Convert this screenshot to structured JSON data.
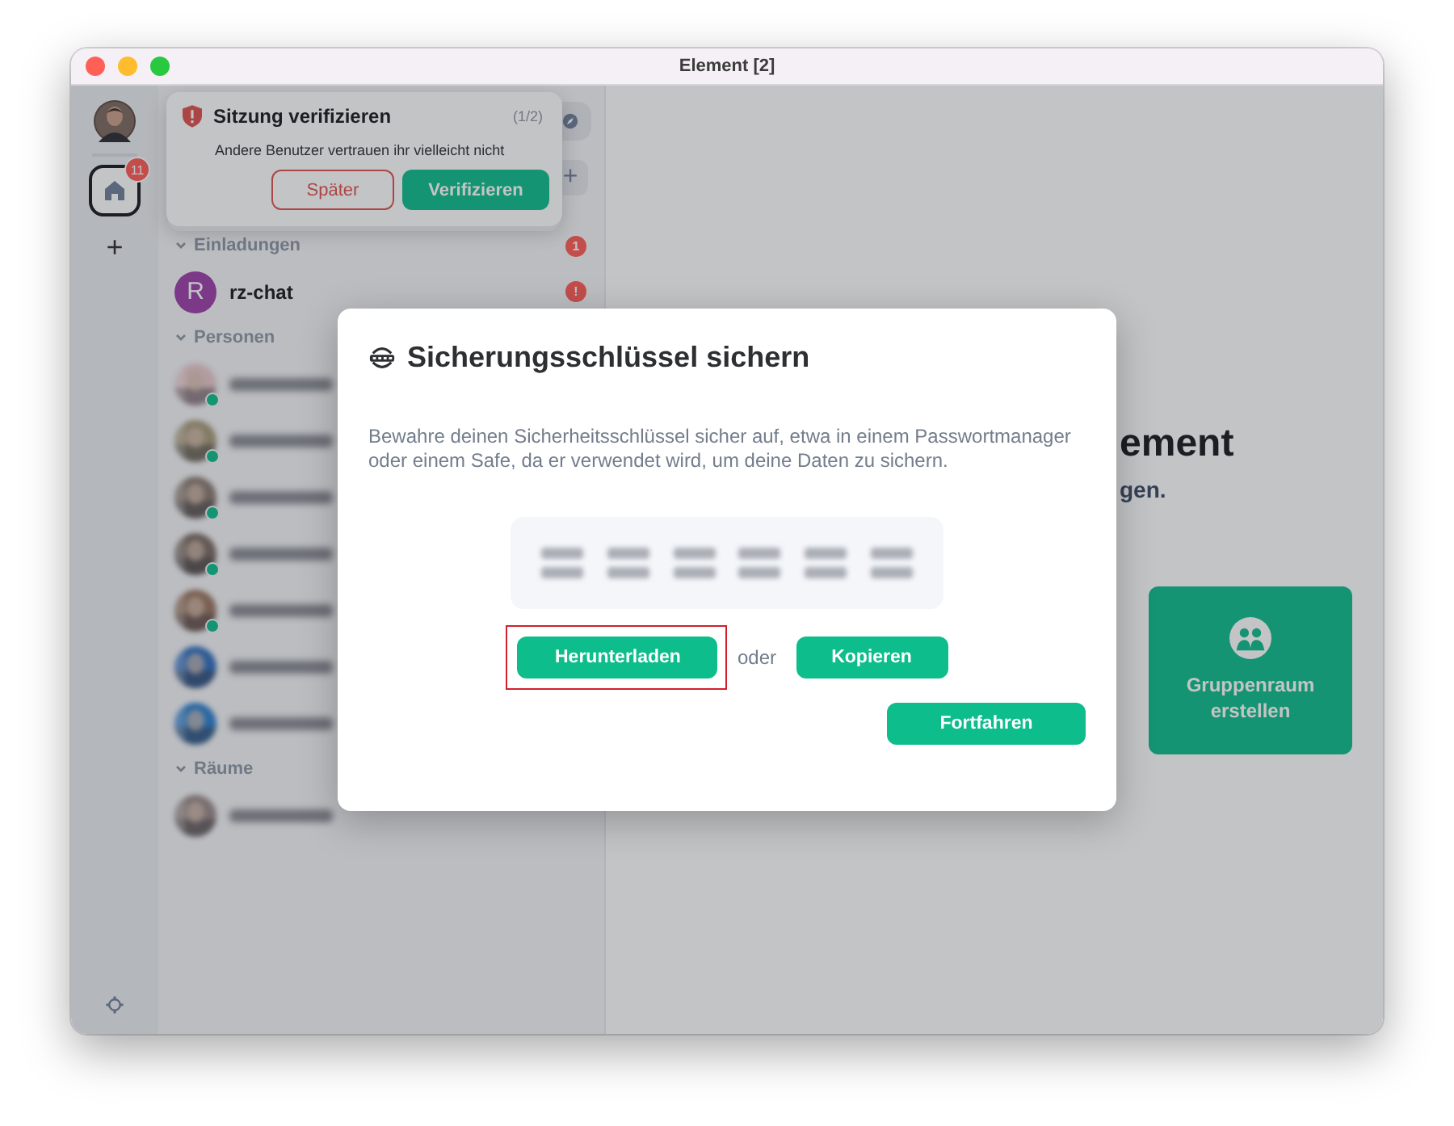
{
  "window": {
    "title": "Element [2]"
  },
  "space_bar": {
    "home": {
      "selected": true,
      "badge": "11"
    },
    "add_icon": "+"
  },
  "toast": {
    "title": "Sitzung verifizieren",
    "counter": "(1/2)",
    "message": "Andere Benutzer vertrauen ihr vielleicht nicht",
    "buttons": [
      {
        "label": "Später",
        "kind": "outline"
      },
      {
        "label": "Verifizieren",
        "kind": "primary"
      }
    ]
  },
  "room_list": {
    "sections": [
      {
        "title": "Einladungen",
        "expanded": true,
        "badge": "1",
        "items": [
          {
            "kind": "room",
            "letter": "R",
            "name": "rz-chat",
            "badge": "!"
          }
        ]
      },
      {
        "title": "Personen",
        "expanded": true,
        "items": [
          {
            "kind": "person",
            "online": true
          },
          {
            "kind": "person",
            "online": true
          },
          {
            "kind": "person",
            "online": true
          },
          {
            "kind": "person",
            "online": true
          },
          {
            "kind": "person",
            "online": true
          },
          {
            "kind": "person",
            "online": false
          },
          {
            "kind": "person",
            "online": false
          }
        ]
      },
      {
        "title": "Räume",
        "expanded": true,
        "items": [
          {
            "kind": "person",
            "online": false
          }
        ]
      }
    ],
    "add_button": "+"
  },
  "main": {
    "heading": "ement",
    "subtitle": "gen.",
    "card": {
      "label": "Gruppenraum erstellen"
    }
  },
  "dialog": {
    "title": "Sicherungsschlüssel sichern",
    "body": "Bewahre deinen Sicherheitsschlüssel sicher auf, etwa in einem Passwortmanager oder einem Safe, da er verwendet wird, um deine Daten zu sichern.",
    "download": {
      "label": "Herunterladen",
      "highlighted": true
    },
    "separator": "oder",
    "copy": {
      "label": "Kopieren"
    },
    "continue": {
      "label": "Fortfahren"
    }
  }
}
